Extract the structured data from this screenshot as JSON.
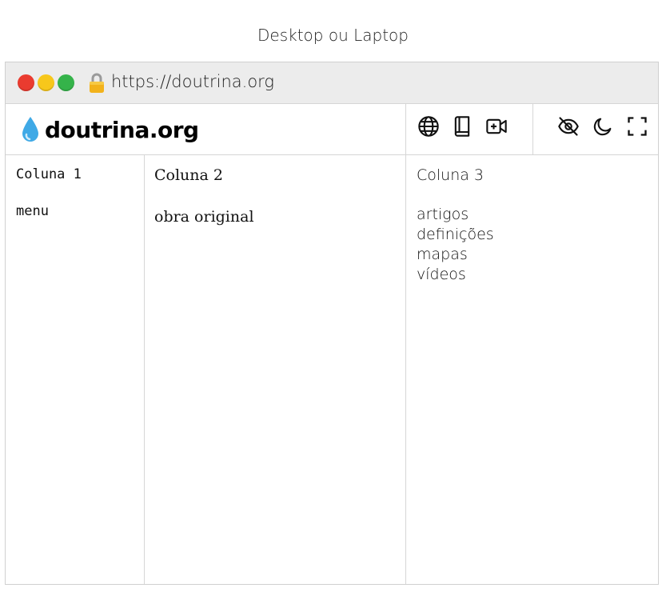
{
  "caption": "Desktop ou Laptop",
  "browser": {
    "url": "https://doutrina.org",
    "traffic_lights": [
      "#ea3b2f",
      "#f7c71b",
      "#35b34a"
    ]
  },
  "header": {
    "brand": "doutrina.org",
    "logo_icon": "droplet-icon",
    "icons_left": [
      "globe-icon",
      "book-icon",
      "video-plus-icon"
    ],
    "icons_right": [
      "eye-off-icon",
      "moon-icon",
      "fullscreen-icon"
    ]
  },
  "columns": {
    "col1": {
      "title": "Coluna 1",
      "item": "menu"
    },
    "col2": {
      "title": "Coluna 2",
      "item": "obra original"
    },
    "col3": {
      "title": "Coluna 3",
      "items": [
        "artigos",
        "definições",
        "mapas",
        "vídeos"
      ]
    }
  }
}
